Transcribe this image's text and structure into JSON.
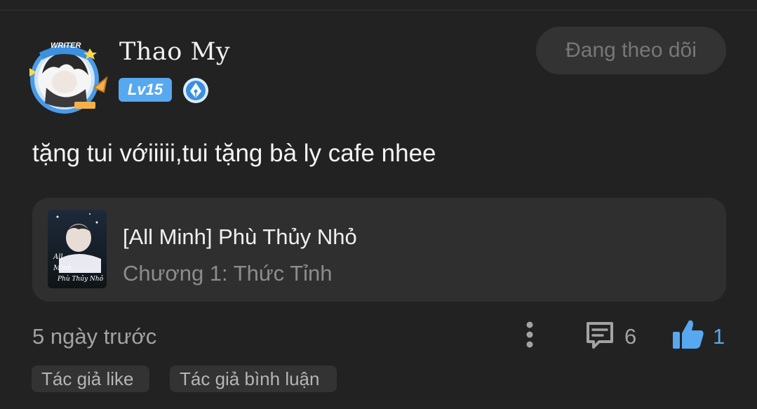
{
  "author": {
    "name": "Thao My",
    "level": "Lv15",
    "avatar_frame_label": "WRITER"
  },
  "follow_button": {
    "label": "Đang theo dõi"
  },
  "comment": {
    "text": "tặng tui vớiiiii,tui tặng bà ly cafe nhee"
  },
  "story": {
    "title": "[All Minh] Phù Thủy Nhỏ",
    "chapter": "Chương 1: Thức Tỉnh",
    "cover_text": [
      "All",
      "Minh",
      "Phù Thủy Nhỏ"
    ]
  },
  "footer": {
    "timestamp": "5 ngày trước",
    "comment_count": "6",
    "like_count": "1"
  },
  "tags": [
    {
      "label": "Tác giả like"
    },
    {
      "label": "Tác giả bình luận"
    }
  ],
  "colors": {
    "background": "#222222",
    "accent": "#58a8f0",
    "card": "#2f2f2f",
    "muted_text": "#a3a3a3"
  },
  "icons": {
    "more": "more-vertical-icon",
    "comment": "comment-icon",
    "like": "thumbs-up-icon",
    "badge": "pen-nib-badge-icon"
  }
}
